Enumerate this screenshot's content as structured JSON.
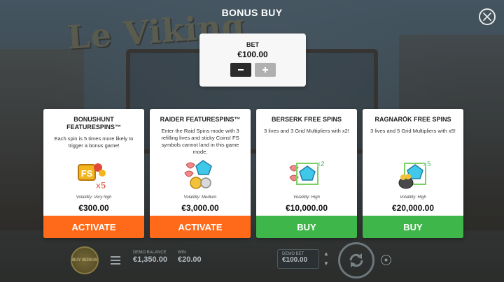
{
  "header": {
    "title": "BONUS BUY"
  },
  "background": {
    "logo_text": "Le Viking"
  },
  "bet": {
    "label": "BET",
    "value": "€100.00",
    "minus_icon": "minus-icon",
    "plus_icon": "plus-icon"
  },
  "cards": [
    {
      "title": "BONUSHUNT FEATURESPINS™",
      "description": "Each spin is 5 times more likely to trigger a bonus game!",
      "volatility": "Volatility: Very high",
      "price": "€300.00",
      "button": "ACTIVATE",
      "button_color": "#ff6a1a",
      "badge": "x5"
    },
    {
      "title": "RAIDER FEATURESPINS™",
      "description": "Enter the Raid Spins mode with 3 refilling lives and sticky Coins! FS symbols cannot land in this game mode.",
      "volatility": "Volatility: Medium",
      "price": "€3,000.00",
      "button": "ACTIVATE",
      "button_color": "#ff6a1a"
    },
    {
      "title": "BERSERK FREE SPINS",
      "description": "3 lives and 3 Grid Multipliers with x2!",
      "volatility": "Volatility: High",
      "price": "€10,000.00",
      "button": "BUY",
      "button_color": "#3fb64a",
      "badge": "x2"
    },
    {
      "title": "RAGNARÖK FREE SPINS",
      "description": "3 lives and 5 Grid Multipliers with x5!",
      "volatility": "Volatility: High",
      "price": "€20,000.00",
      "button": "BUY",
      "button_color": "#3fb64a",
      "badge": "x5"
    }
  ],
  "bottom": {
    "buy_bonus": "BUY BONUS",
    "demo_balance_label": "DEMO BALANCE",
    "demo_balance_value": "€1,350.00",
    "win_label": "WIN",
    "win_value": "€20.00",
    "demo_bet_label": "DEMO BET",
    "demo_bet_value": "€100.00"
  },
  "colors": {
    "orange": "#ff6a1a",
    "green": "#3fb64a"
  }
}
